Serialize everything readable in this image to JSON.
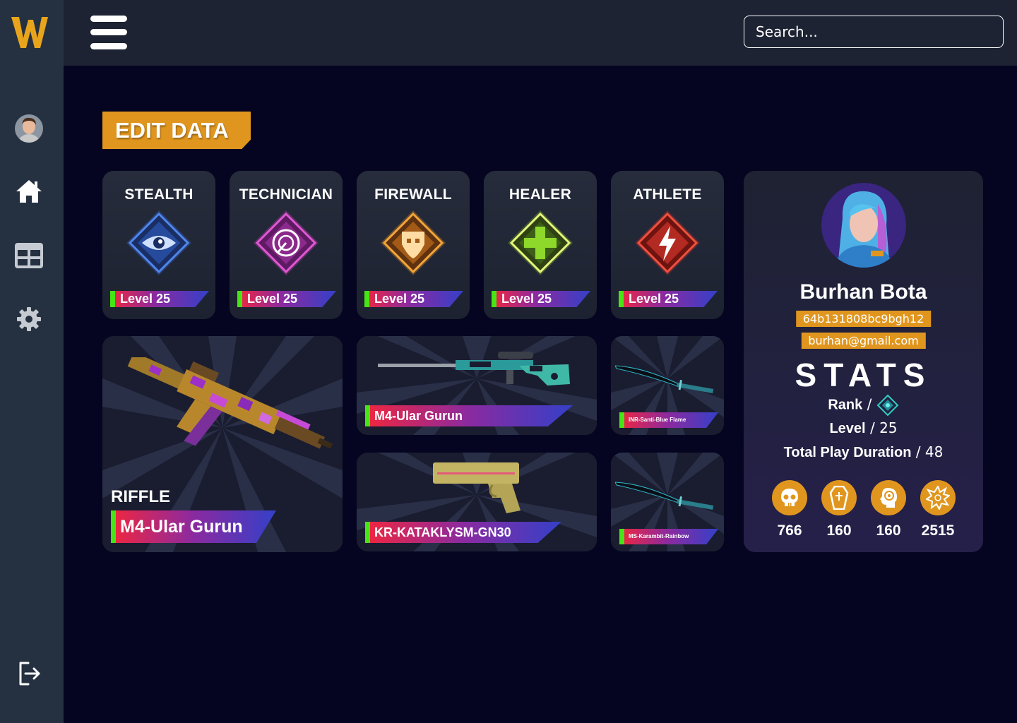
{
  "app": {
    "logo_letter": "W"
  },
  "search": {
    "placeholder": "Search..."
  },
  "edit_button": {
    "label": "EDIT DATA"
  },
  "skills": [
    {
      "title": "STEALTH",
      "level": "Level 25",
      "icon": "eye-icon",
      "color": "#3b6fd6"
    },
    {
      "title": "TECHNICIAN",
      "level": "Level 25",
      "icon": "radar-icon",
      "color": "#c23fb6"
    },
    {
      "title": "FIREWALL",
      "level": "Level 25",
      "icon": "shield-skull-icon",
      "color": "#e08a1e"
    },
    {
      "title": "HEALER",
      "level": "Level 25",
      "icon": "cross-icon",
      "color": "#8fd12b"
    },
    {
      "title": "ATHLETE",
      "level": "Level 25",
      "icon": "lightning-icon",
      "color": "#e0322b"
    }
  ],
  "weapons": {
    "primary": {
      "type": "RIFFLE",
      "name": "M4-Ular Gurun"
    },
    "sniper": {
      "name": "M4-Ular Gurun"
    },
    "pistol": {
      "name": "KR-KATAKLYSM-GN30"
    },
    "knife1": {
      "name": "INR-Santi-Blue Flame"
    },
    "knife2": {
      "name": "MS-Karambit-Rainbow"
    }
  },
  "profile": {
    "name": "Burhan Bota",
    "id": "64b131808bc9bgh12",
    "email": "burhan@gmail.com",
    "stats_title": "STATS",
    "rank_label": "Rank",
    "level_label": "Level",
    "level_value": "25",
    "duration_label": "Total Play Duration",
    "duration_value": "48",
    "separator": " / "
  },
  "stats": [
    {
      "icon": "skull-icon",
      "value": "766"
    },
    {
      "icon": "coffin-icon",
      "value": "160"
    },
    {
      "icon": "headshot-icon",
      "value": "160"
    },
    {
      "icon": "explosion-icon",
      "value": "2515"
    }
  ],
  "colors": {
    "accent": "#e0961e",
    "sidebar": "#253140",
    "header": "#1d2332",
    "background": "#060521",
    "level_green": "#46e515"
  }
}
